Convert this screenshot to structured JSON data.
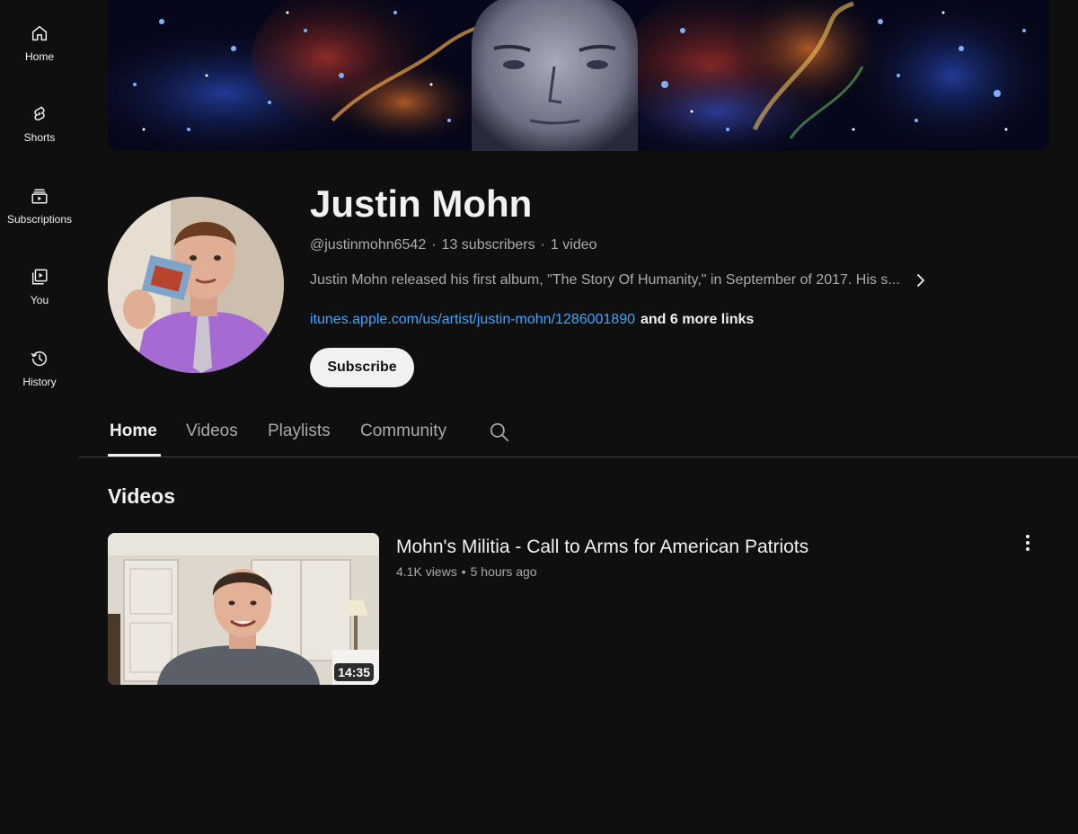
{
  "nav": {
    "items": [
      {
        "label": "Home",
        "icon": "home-icon"
      },
      {
        "label": "Shorts",
        "icon": "shorts-icon"
      },
      {
        "label": "Subscriptions",
        "icon": "subscriptions-icon"
      },
      {
        "label": "You",
        "icon": "you-library-icon"
      },
      {
        "label": "History",
        "icon": "history-icon"
      }
    ]
  },
  "channel": {
    "name": "Justin Mohn",
    "handle": "@justinmohn6542",
    "separator": "·",
    "subscribers": "13 subscribers",
    "video_count": "1 video",
    "description": "Justin Mohn released his first album, \"The Story Of Humanity,\" in September of 2017. His s...",
    "link_url": "itunes.apple.com/us/artist/justin-mohn/1286001890",
    "link_more": "and 6 more links",
    "subscribe_label": "Subscribe"
  },
  "tabs": [
    {
      "label": "Home",
      "active": true
    },
    {
      "label": "Videos",
      "active": false
    },
    {
      "label": "Playlists",
      "active": false
    },
    {
      "label": "Community",
      "active": false
    }
  ],
  "section": {
    "title": "Videos"
  },
  "video": {
    "title": "Mohn's Militia - Call to Arms for American Patriots",
    "views": "4.1K views",
    "dot": "•",
    "age": "5 hours ago",
    "duration": "14:35"
  },
  "colors": {
    "background": "#0f0f0f",
    "text_primary": "#f1f1f1",
    "text_secondary": "#aaaaaa",
    "link": "#3ea6ff",
    "divider": "#3f3f3f"
  }
}
